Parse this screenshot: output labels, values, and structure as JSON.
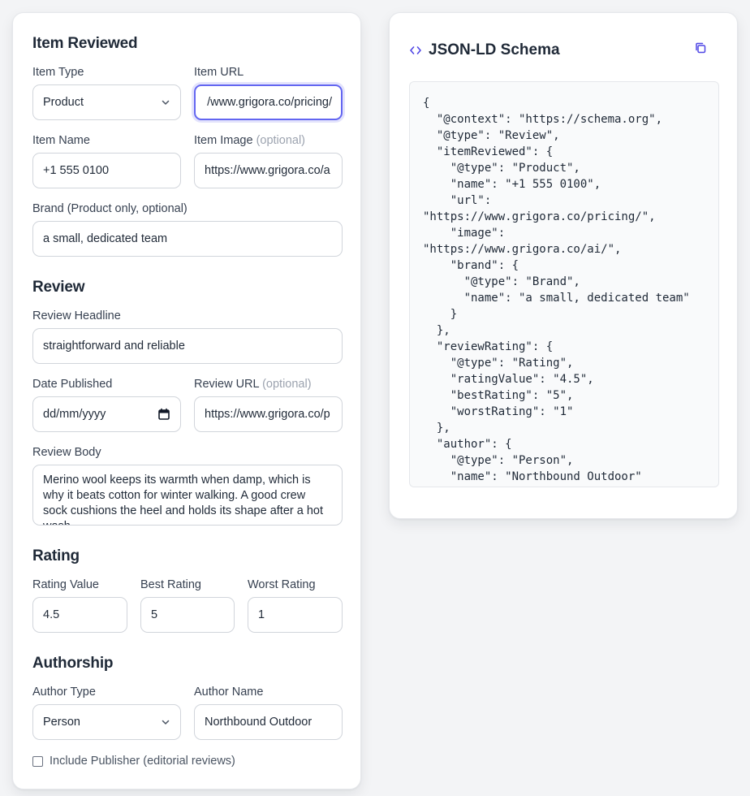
{
  "form": {
    "item_reviewed": {
      "title": "Item Reviewed",
      "item_type_label": "Item Type",
      "item_type_value": "Product",
      "item_url_label": "Item URL",
      "item_url_value": "/www.grigora.co/pricing/",
      "item_name_label": "Item Name",
      "item_name_value": "+1 555 0100",
      "item_image_label": "Item Image",
      "item_image_optional": "(optional)",
      "item_image_value": "https://www.grigora.co/a",
      "brand_label": "Brand (Product only, optional)",
      "brand_value": "a small, dedicated team"
    },
    "review": {
      "title": "Review",
      "headline_label": "Review Headline",
      "headline_value": "straightforward and reliable",
      "date_label": "Date Published",
      "date_placeholder": "dd/mm/yyyy",
      "review_url_label": "Review URL",
      "review_url_optional": "(optional)",
      "review_url_value": "https://www.grigora.co/p",
      "body_label": "Review Body",
      "body_value": "Merino wool keeps its warmth when damp, which is why it beats cotton for winter walking. A good crew sock cushions the heel and holds its shape after a hot wash."
    },
    "rating": {
      "title": "Rating",
      "value_label": "Rating Value",
      "value": "4.5",
      "best_label": "Best Rating",
      "best": "5",
      "worst_label": "Worst Rating",
      "worst": "1"
    },
    "authorship": {
      "title": "Authorship",
      "author_type_label": "Author Type",
      "author_type_value": "Person",
      "author_name_label": "Author Name",
      "author_name_value": "Northbound Outdoor",
      "publisher_checkbox_label": "Include Publisher (editorial reviews)",
      "publisher_checked": false
    }
  },
  "schema": {
    "title": "JSON-LD Schema",
    "code": "{\n  \"@context\": \"https://schema.org\",\n  \"@type\": \"Review\",\n  \"itemReviewed\": {\n    \"@type\": \"Product\",\n    \"name\": \"+1 555 0100\",\n    \"url\":\n\"https://www.grigora.co/pricing/\",\n    \"image\":\n\"https://www.grigora.co/ai/\",\n    \"brand\": {\n      \"@type\": \"Brand\",\n      \"name\": \"a small, dedicated team\"\n    }\n  },\n  \"reviewRating\": {\n    \"@type\": \"Rating\",\n    \"ratingValue\": \"4.5\",\n    \"bestRating\": \"5\",\n    \"worstRating\": \"1\"\n  },\n  \"author\": {\n    \"@type\": \"Person\",\n    \"name\": \"Northbound Outdoor\"\n  }\n}"
  },
  "icons": {
    "code": "code-brackets-icon",
    "copy": "copy-icon",
    "chevron": "chevron-down-icon",
    "calendar": "calendar-icon"
  },
  "colors": {
    "accent": "#6366f1",
    "icon_accent": "#4f46e5",
    "text": "#1f2937",
    "muted": "#9ca3af"
  }
}
